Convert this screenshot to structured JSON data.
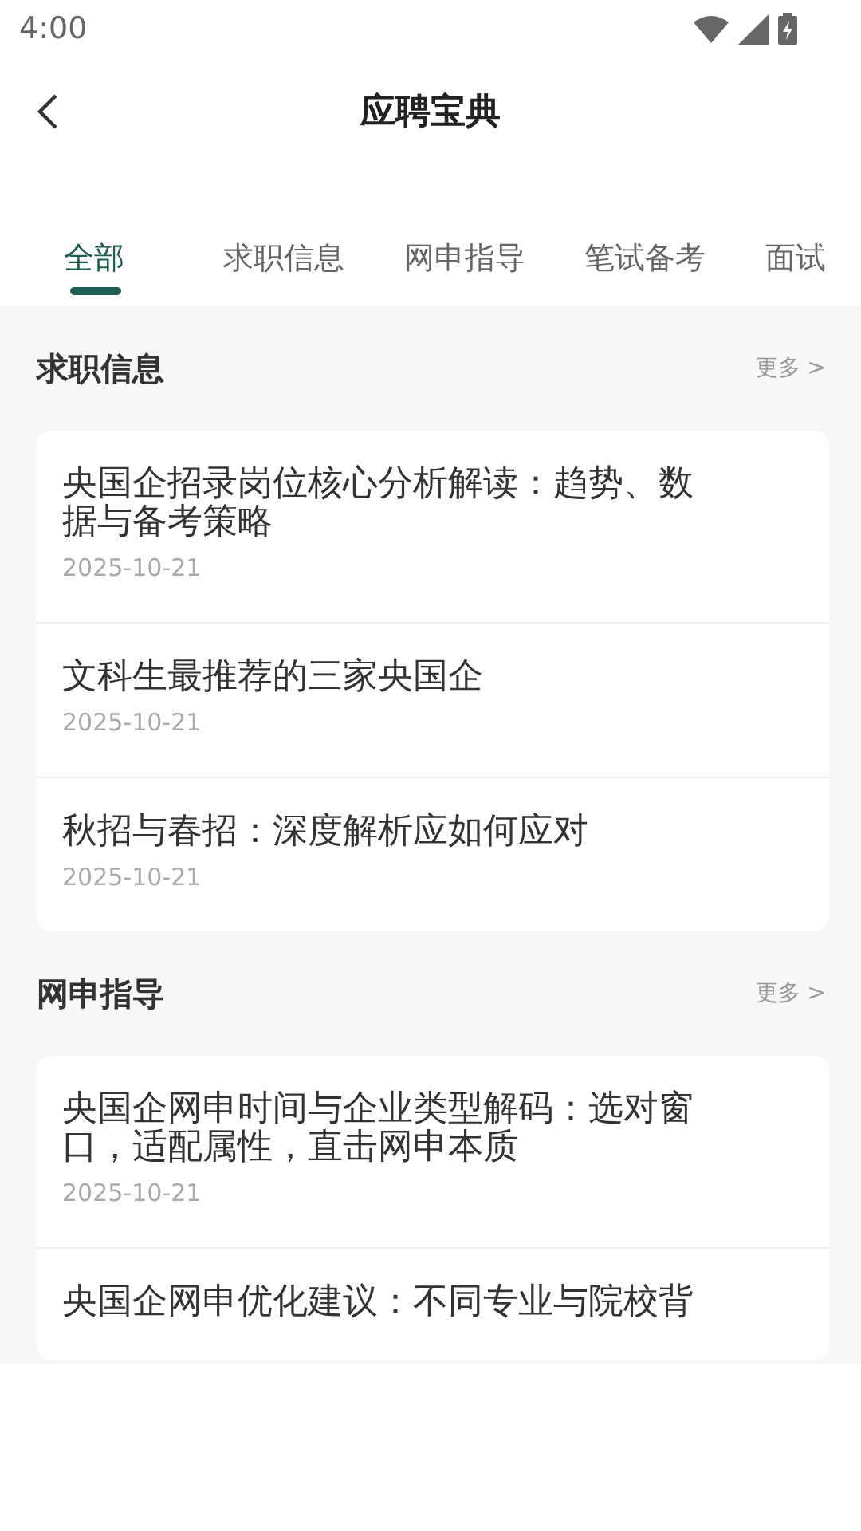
{
  "status_bar": {
    "time": "4:00"
  },
  "header": {
    "title": "应聘宝典"
  },
  "tabs": [
    {
      "label": "全部",
      "selected": true
    },
    {
      "label": "求职信息",
      "selected": false
    },
    {
      "label": "网申指导",
      "selected": false
    },
    {
      "label": "笔试备考",
      "selected": false
    },
    {
      "label": "面试",
      "selected": false
    }
  ],
  "sections": [
    {
      "title": "求职信息",
      "more": "更多 >",
      "articles": [
        {
          "title": "央国企招录岗位核心分析解读：趋势、数据与备考策略",
          "date": "2025-10-21"
        },
        {
          "title": "文科生最推荐的三家央国企",
          "date": "2025-10-21"
        },
        {
          "title": "秋招与春招：深度解析应如何应对",
          "date": "2025-10-21"
        }
      ]
    },
    {
      "title": "网申指导",
      "more": "更多 >",
      "articles": [
        {
          "title": "央国企网申时间与企业类型解码：选对窗口，适配属性，直击网申本质",
          "date": "2025-10-21"
        },
        {
          "title": "央国企网申优化建议：不同专业与院校背"
        }
      ]
    }
  ]
}
